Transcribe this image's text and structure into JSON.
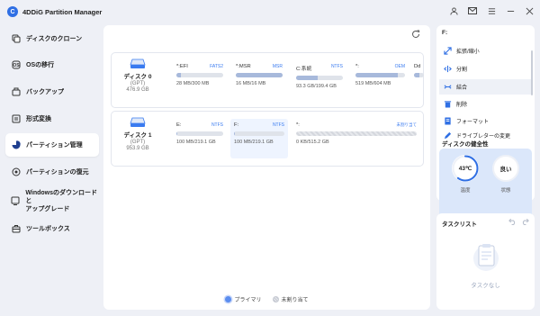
{
  "app": {
    "title": "4DDiG Partition Manager",
    "logo_letter": "C"
  },
  "window_controls": [
    "user-icon",
    "mail-icon",
    "settings-icon",
    "minimize-icon",
    "close-icon"
  ],
  "sidebar": {
    "items": [
      {
        "label": "ディスクのクローン",
        "icon": "disk-clone-icon",
        "active": false
      },
      {
        "label": "OSの移行",
        "icon": "os-migrate-icon",
        "active": false
      },
      {
        "label": "バックアップ",
        "icon": "backup-icon",
        "active": false
      },
      {
        "label": "形式変換",
        "icon": "convert-icon",
        "active": false
      },
      {
        "label": "パーティション管理",
        "icon": "pie-chart-icon",
        "active": true
      },
      {
        "label": "パーティションの復元",
        "icon": "restore-icon",
        "active": false
      },
      {
        "label": "Windowsのダウンロードと\nアップグレード",
        "icon": "windows-icon",
        "active": false
      },
      {
        "label": "ツールボックス",
        "icon": "toolbox-icon",
        "active": false
      }
    ]
  },
  "disks": [
    {
      "name": "ディスク 0",
      "style": "(GPT)",
      "size": "476.9 GB",
      "partitions": [
        {
          "label": "*:EFI",
          "fs": "FATS2",
          "size": "28 MB/300 MB",
          "used": 0.09
        },
        {
          "label": "*:MSR",
          "fs": "MSR",
          "size": "16 MB/16 MB",
          "used": 1.0
        },
        {
          "label": "C:系統",
          "fs": "NTFS",
          "size": "93.3 GB/199.4 GB",
          "used": 0.47
        },
        {
          "label": "*:",
          "fs": "OEM",
          "size": "519 MB/604 MB",
          "used": 0.86
        },
        {
          "label": "Dd",
          "fs": "",
          "size": "",
          "used": 0.5
        }
      ]
    },
    {
      "name": "ディスク 1",
      "style": "(GPT)",
      "size": "953.9 GB",
      "partitions": [
        {
          "label": "E:",
          "fs": "NTFS",
          "size": "100 MB/219.1 GB",
          "used": 0.02,
          "selected": false
        },
        {
          "label": "F:",
          "fs": "NTFS",
          "size": "100 MB/219.1 GB",
          "used": 0.02,
          "selected": true
        },
        {
          "label": "*:",
          "fs": "未割り当て",
          "size": "0 KB/515.2 GB",
          "unallocated": true
        }
      ]
    }
  ],
  "legend": [
    {
      "label": "プライマリ",
      "color": "#5b8def"
    },
    {
      "label": "未割り当て",
      "color": "#c5c9d2"
    }
  ],
  "ops_panel": {
    "drive": "F:",
    "items": [
      {
        "label": "拡張/縮小",
        "icon": "resize-icon"
      },
      {
        "label": "分割",
        "icon": "split-icon"
      },
      {
        "label": "結合",
        "icon": "merge-icon",
        "active": true
      },
      {
        "label": "削除",
        "icon": "delete-icon"
      },
      {
        "label": "フォーマット",
        "icon": "format-icon"
      },
      {
        "label": "ドライブレターの変更",
        "icon": "edit-icon"
      }
    ],
    "health_title": "ディスクの健全性",
    "temperature": "43℃",
    "temperature_label": "温度",
    "temperature_level": 0.6,
    "status": "良い",
    "status_label": "状態",
    "accent": "#2f6fe4"
  },
  "tasks": {
    "title": "タスクリスト",
    "empty": "タスクなし"
  }
}
